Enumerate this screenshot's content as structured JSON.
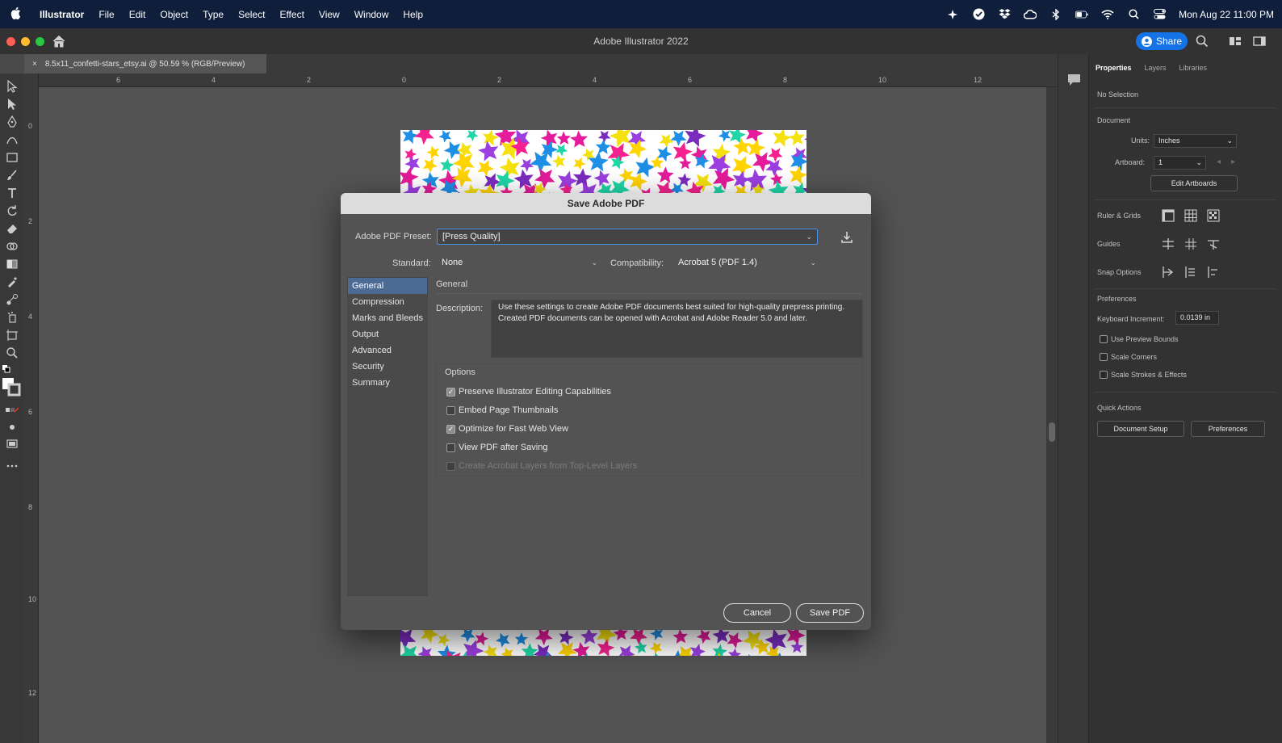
{
  "menubar": {
    "app_name": "Illustrator",
    "items": [
      "File",
      "Edit",
      "Object",
      "Type",
      "Select",
      "Effect",
      "View",
      "Window",
      "Help"
    ],
    "clock": "Mon Aug 22  11:00 PM"
  },
  "titlebar": {
    "title": "Adobe Illustrator 2022",
    "share_label": "Share"
  },
  "document_tab": {
    "close_glyph": "×",
    "label": "8.5x11_confetti-stars_etsy.ai @ 50.59 % (RGB/Preview)"
  },
  "rulers": {
    "horizontal_ticks": [
      "6",
      "4",
      "2",
      "0",
      "2",
      "4",
      "6",
      "8",
      "10",
      "12"
    ],
    "vertical_ticks": [
      "0",
      "2",
      "4",
      "6",
      "8",
      "10",
      "12"
    ]
  },
  "artwork": {
    "star_colors": [
      "#e41b9a",
      "#9b3fe0",
      "#1e8fe6",
      "#f5e10f",
      "#20d6a7",
      "#f4218e",
      "#7b2cbf",
      "#ffd400"
    ]
  },
  "properties_panel": {
    "tabs": [
      "Properties",
      "Layers",
      "Libraries"
    ],
    "selection_state": "No Selection",
    "document_heading": "Document",
    "units_label": "Units:",
    "units_value": "Inches",
    "artboard_label": "Artboard:",
    "artboard_value": "1",
    "edit_artboards_label": "Edit Artboards",
    "ruler_grids_label": "Ruler & Grids",
    "guides_label": "Guides",
    "snap_options_label": "Snap Options",
    "preferences_heading": "Preferences",
    "keyboard_increment_label": "Keyboard Increment:",
    "keyboard_increment_value": "0.0139 in",
    "use_preview_bounds_label": "Use Preview Bounds",
    "scale_corners_label": "Scale Corners",
    "scale_strokes_label": "Scale Strokes & Effects",
    "quick_actions_heading": "Quick Actions",
    "document_setup_label": "Document Setup",
    "preferences_button_label": "Preferences"
  },
  "dialog": {
    "title": "Save Adobe PDF",
    "preset_label": "Adobe PDF Preset:",
    "preset_value": "[Press Quality]",
    "standard_label": "Standard:",
    "standard_value": "None",
    "compatibility_label": "Compatibility:",
    "compatibility_value": "Acrobat 5 (PDF 1.4)",
    "sections": [
      "General",
      "Compression",
      "Marks and Bleeds",
      "Output",
      "Advanced",
      "Security",
      "Summary"
    ],
    "active_section": "General",
    "section_heading": "General",
    "description_label": "Description:",
    "description_text": "Use these settings to create Adobe PDF documents best suited for high-quality prepress printing.  Created PDF documents can be opened with Acrobat and Adobe Reader 5.0 and later.",
    "options_heading": "Options",
    "options": [
      {
        "label": "Preserve Illustrator Editing Capabilities",
        "checked": true,
        "enabled": true
      },
      {
        "label": "Embed Page Thumbnails",
        "checked": false,
        "enabled": true
      },
      {
        "label": "Optimize for Fast Web View",
        "checked": true,
        "enabled": true
      },
      {
        "label": "View PDF after Saving",
        "checked": false,
        "enabled": true
      },
      {
        "label": "Create Acrobat Layers from Top-Level Layers",
        "checked": false,
        "enabled": false
      }
    ],
    "check_glyph": "✓",
    "cancel_label": "Cancel",
    "save_label": "Save PDF"
  },
  "colors": {
    "accent_blue": "#1473e6",
    "selection_blue": "#4c6b94",
    "menubar_bg": "#0f1e3a"
  }
}
